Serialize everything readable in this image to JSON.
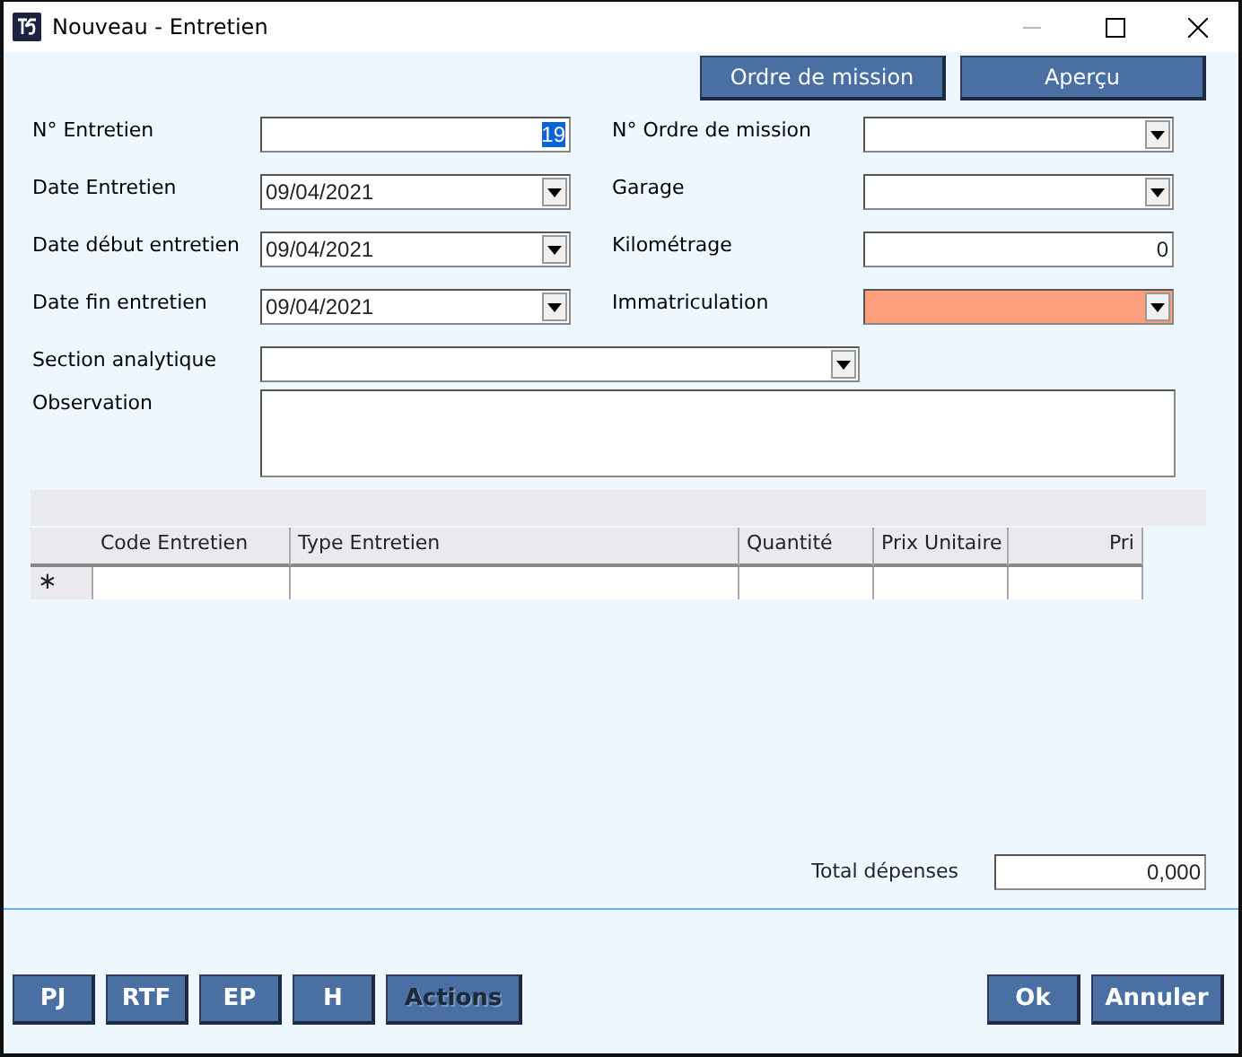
{
  "window": {
    "title": "Nouveau - Entretien"
  },
  "top_buttons": [
    "Ordre de mission",
    "Aperçu"
  ],
  "fields_left": [
    {
      "label": "N° Entretien",
      "kind": "number",
      "value": "19",
      "selected_text": true
    },
    {
      "label": "Date Entretien",
      "kind": "combo",
      "value": "09/04/2021"
    },
    {
      "label": "Date début entretien",
      "kind": "combo",
      "value": "09/04/2021"
    },
    {
      "label": "Date fin entretien",
      "kind": "combo",
      "value": "09/04/2021"
    }
  ],
  "fields_right": [
    {
      "label": "N° Ordre de mission",
      "kind": "combo"
    },
    {
      "label": "Garage",
      "kind": "combo"
    },
    {
      "label": "Kilométrage",
      "kind": "number",
      "value": "0"
    },
    {
      "label": "Immatriculation",
      "kind": "combo",
      "required": true
    }
  ],
  "section": {
    "label": "Section analytique",
    "kind": "combo"
  },
  "observation": {
    "label": "Observation"
  },
  "table": {
    "columns": [
      "Code Entretien",
      "Type Entretien",
      "Quantité",
      "Prix Unitaire",
      "Pri"
    ],
    "new_row_marker": "∗"
  },
  "total": {
    "label": "Total dépenses",
    "value": "0,000"
  },
  "bottom_left_buttons": [
    {
      "label": "PJ",
      "disabled": false
    },
    {
      "label": "RTF",
      "disabled": false
    },
    {
      "label": "EP",
      "disabled": false
    },
    {
      "label": "H",
      "disabled": false
    },
    {
      "label": "Actions",
      "disabled": true
    }
  ],
  "bottom_right_buttons": [
    "Ok",
    "Annuler"
  ]
}
